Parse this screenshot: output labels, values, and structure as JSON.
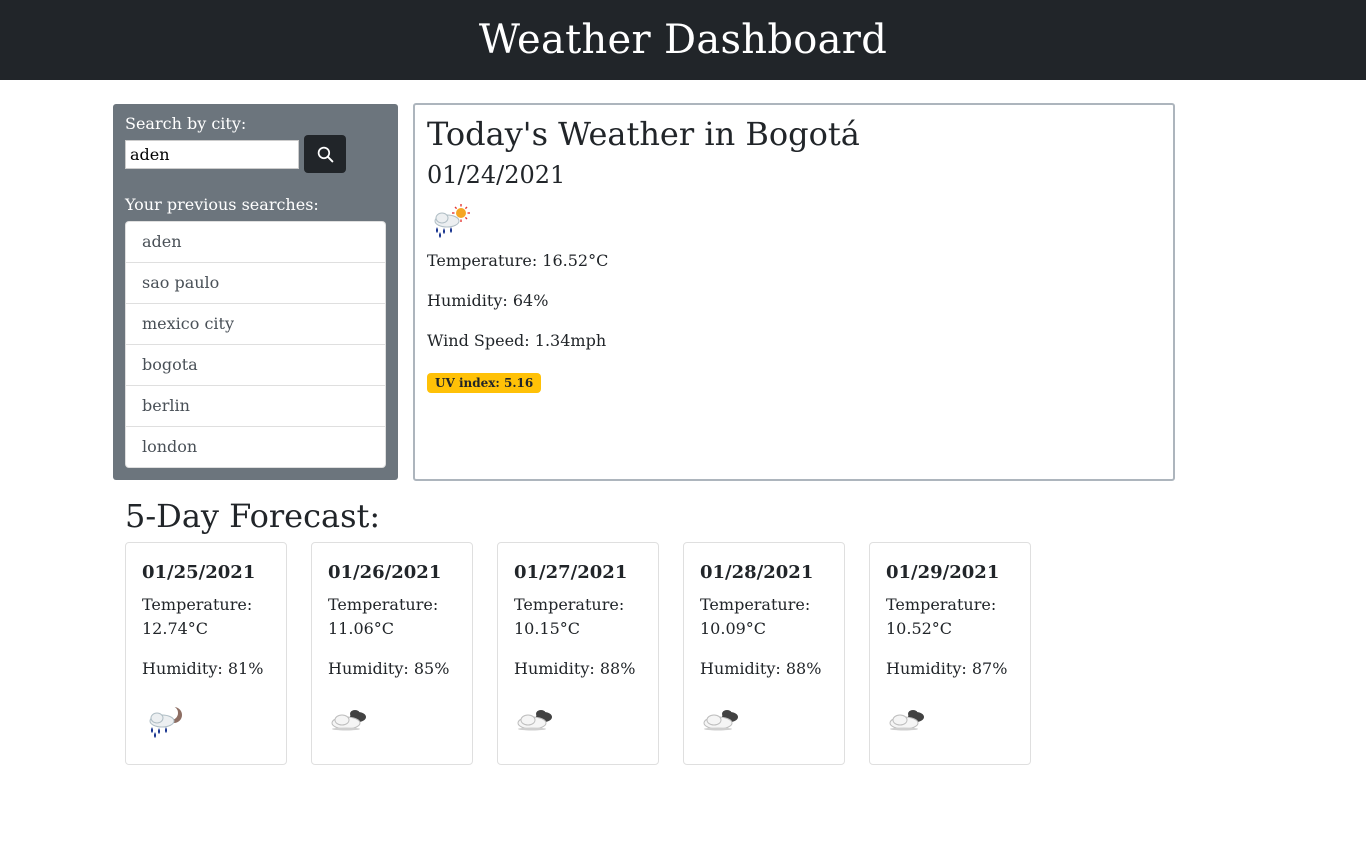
{
  "header": {
    "title": "Weather Dashboard"
  },
  "search": {
    "label": "Search by city:",
    "value": "aden",
    "button_icon": "search-icon"
  },
  "history": {
    "label": "Your previous searches:",
    "items": [
      "aden",
      "sao paulo",
      "mexico city",
      "bogota",
      "berlin",
      "london"
    ]
  },
  "today": {
    "title": "Today's Weather in Bogotá",
    "date": "01/24/2021",
    "icon": "rain-sun-icon",
    "temperature": "Temperature: 16.52°C",
    "humidity": "Humidity: 64%",
    "wind": "Wind Speed: 1.34mph",
    "uv": "UV index: 5.16",
    "uv_color": "#ffc107"
  },
  "forecast": {
    "title": "5-Day Forecast:",
    "days": [
      {
        "date": "01/25/2021",
        "temp_label": "Temperature:",
        "temp": "12.74°C",
        "humidity": "Humidity: 81%",
        "icon": "rain-moon-icon"
      },
      {
        "date": "01/26/2021",
        "temp_label": "Temperature:",
        "temp": "11.06°C",
        "humidity": "Humidity: 85%",
        "icon": "cloudy-icon"
      },
      {
        "date": "01/27/2021",
        "temp_label": "Temperature:",
        "temp": "10.15°C",
        "humidity": "Humidity: 88%",
        "icon": "cloudy-icon"
      },
      {
        "date": "01/28/2021",
        "temp_label": "Temperature:",
        "temp": "10.09°C",
        "humidity": "Humidity: 88%",
        "icon": "cloudy-icon"
      },
      {
        "date": "01/29/2021",
        "temp_label": "Temperature:",
        "temp": "10.52°C",
        "humidity": "Humidity: 87%",
        "icon": "cloudy-icon"
      }
    ]
  },
  "colors": {
    "header_bg": "#212529",
    "sidebar_bg": "#6c757d",
    "uv_badge": "#ffc107"
  }
}
